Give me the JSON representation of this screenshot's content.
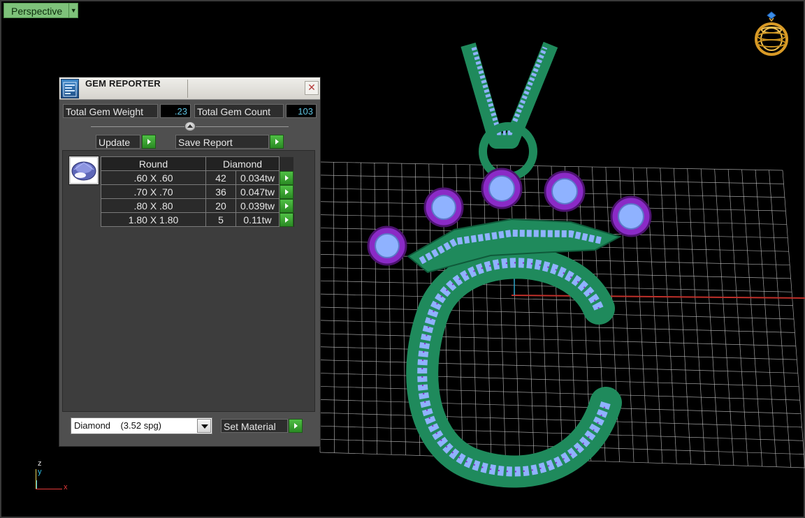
{
  "viewport": {
    "view_name": "Perspective",
    "axis_labels": {
      "z": "z",
      "y": "y",
      "x": "x"
    }
  },
  "gem_reporter": {
    "title": "GEM REPORTER",
    "close_symbol": "✕",
    "total_weight_label": "Total Gem Weight",
    "total_weight_value": ".23",
    "total_count_label": "Total Gem Count",
    "total_count_value": "103",
    "update_label": "Update",
    "save_report_label": "Save Report",
    "table": {
      "shape_header": "Round",
      "material_header": "Diamond",
      "rows": [
        {
          "size": ".60 X .60",
          "count": "42",
          "weight": "0.034tw"
        },
        {
          "size": ".70 X .70",
          "count": "36",
          "weight": "0.047tw"
        },
        {
          "size": ".80 X .80",
          "count": "20",
          "weight": "0.039tw"
        },
        {
          "size": "1.80 X 1.80",
          "count": "5",
          "weight": "0.11tw"
        }
      ]
    },
    "material_select_value": "Diamond    (3.52 spg)",
    "set_material_label": "Set Material"
  },
  "colors": {
    "view_label_bg": "#7ec27a",
    "metal_green": "#1f8a5c",
    "gem_blue": "#8fb2ff",
    "prong_purple": "#8a2ac6",
    "accent_go_button": "#3aa832",
    "value_text": "#5fc3e0"
  }
}
